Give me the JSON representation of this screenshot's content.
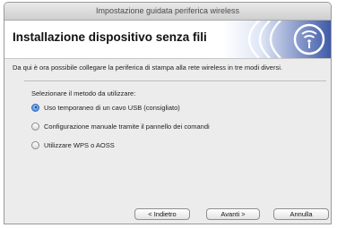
{
  "window": {
    "title": "Impostazione guidata periferica wireless"
  },
  "header": {
    "title": "Installazione dispositivo senza fili",
    "graphic_icon": "wireless-signal-icon"
  },
  "main": {
    "subtitle": "Da qui è ora possibile collegare la periferica di stampa alla rete wireless in tre modi diversi.",
    "prompt": "Selezionare il metodo da utilizzare:",
    "options": [
      {
        "label": "Uso temporaneo di un cavo USB (consigliato)",
        "selected": true
      },
      {
        "label": "Configurazione manuale tramite il pannello dei comandi",
        "selected": false
      },
      {
        "label": "Utilizzare WPS o AOSS",
        "selected": false
      }
    ]
  },
  "buttons": {
    "back": "< Indietro",
    "next": "Avanti >",
    "cancel": "Annulla"
  },
  "colors": {
    "accent": "#3c7fe0",
    "header_graphic": "#3f5aa8"
  }
}
